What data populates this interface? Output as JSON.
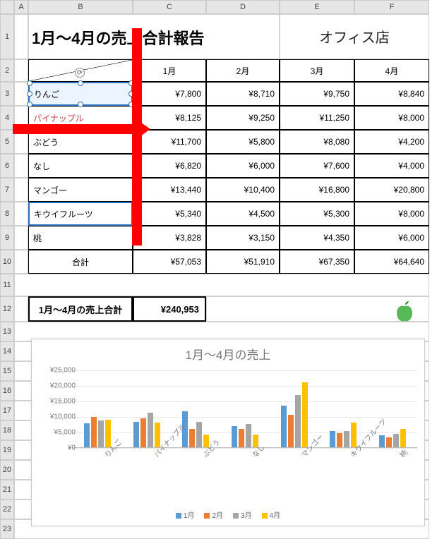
{
  "columns": [
    "A",
    "B",
    "C",
    "D",
    "E",
    "F"
  ],
  "rows": [
    "1",
    "2",
    "3",
    "4",
    "5",
    "6",
    "7",
    "8",
    "9",
    "10",
    "11",
    "12",
    "13",
    "14",
    "15",
    "16",
    "17",
    "18",
    "19",
    "20",
    "21",
    "22",
    "23"
  ],
  "title": "1月～4月の売上合計報告",
  "store": "オフィス店",
  "months": [
    "1月",
    "2月",
    "3月",
    "4月"
  ],
  "products": [
    "りんご",
    "パイナップル",
    "ぶどう",
    "なし",
    "マンゴー",
    "キウイフルーツ",
    "桃"
  ],
  "values": [
    [
      "¥7,800",
      "¥8,710",
      "¥9,750",
      "¥8,840"
    ],
    [
      "¥8,125",
      "¥9,250",
      "¥11,250",
      "¥8,000"
    ],
    [
      "¥11,700",
      "¥5,800",
      "¥8,080",
      "¥4,200"
    ],
    [
      "¥6,820",
      "¥6,000",
      "¥7,600",
      "¥4,000"
    ],
    [
      "¥13,440",
      "¥10,400",
      "¥16,800",
      "¥20,800"
    ],
    [
      "¥5,340",
      "¥4,500",
      "¥5,300",
      "¥8,000"
    ],
    [
      "¥3,828",
      "¥3,150",
      "¥4,350",
      "¥6,000"
    ]
  ],
  "total_label": "合計",
  "totals": [
    "¥57,053",
    "¥51,910",
    "¥67,350",
    "¥64,640"
  ],
  "grand_label": "1月～4月の売上合計",
  "grand_total": "¥240,953",
  "chart_data": {
    "type": "bar",
    "title": "1月～4月の売上",
    "categories": [
      "りんご",
      "パイナップル",
      "ぶどう",
      "なし",
      "マンゴー",
      "キウイフルーツ",
      "桃"
    ],
    "series": [
      {
        "name": "1月",
        "values": [
          7800,
          8125,
          11700,
          6820,
          13440,
          5340,
          3828
        ]
      },
      {
        "name": "2月",
        "values": [
          9750,
          9250,
          5800,
          6000,
          10400,
          4500,
          3150
        ]
      },
      {
        "name": "3月",
        "values": [
          8710,
          11250,
          8080,
          7600,
          16800,
          5300,
          4350
        ]
      },
      {
        "name": "4月",
        "values": [
          8840,
          8000,
          4200,
          4000,
          20800,
          8000,
          6000
        ]
      }
    ],
    "ylabel": "",
    "ylim": [
      0,
      25000
    ],
    "yticks": [
      "¥0",
      "¥5,000",
      "¥10,000",
      "¥15,000",
      "¥20,000",
      "¥25,000"
    ],
    "colors": [
      "#5b9bd5",
      "#ed7d31",
      "#a5a5a5",
      "#ffc000"
    ]
  }
}
